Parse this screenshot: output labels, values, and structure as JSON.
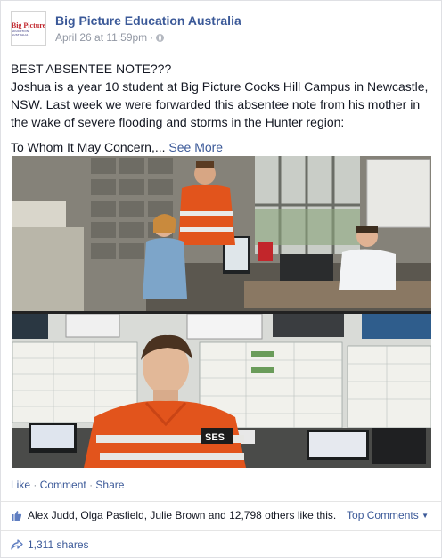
{
  "post": {
    "page_name": "Big Picture Education Australia",
    "date": "April 26 at 11:59pm",
    "separator": "·",
    "avatar_logo_line1": "Big Picture",
    "avatar_logo_line2": "EDUCATION AUSTRALIA",
    "privacy_icon": "globe-icon",
    "headline": "BEST ABSENTEE NOTE???",
    "body": "Joshua is a year 10 student at Big Picture Cooks Hill Campus in Newcastle, NSW. Last week we were forwarded this absentee note from his mother in the wake of severe flooding and storms in the Hunter region:",
    "excerpt": "To Whom It May Concern,...",
    "see_more": "See More"
  },
  "photo": {
    "top_scene": "emergency-operations-centre",
    "bottom_scene": "student-in-ses-uniform",
    "ses_patch_text": "SES"
  },
  "actions": {
    "like": "Like",
    "comment": "Comment",
    "share": "Share",
    "separator": "·"
  },
  "reactions": {
    "likes_text": "Alex Judd, Olga Pasfield, Julie Brown and 12,798 others like this.",
    "top_comments": "Top Comments",
    "shares_text": "1,311 shares"
  },
  "colors": {
    "link": "#3b5998",
    "meta": "#9197a3",
    "text": "#141823",
    "ses_orange": "#e2541c"
  }
}
